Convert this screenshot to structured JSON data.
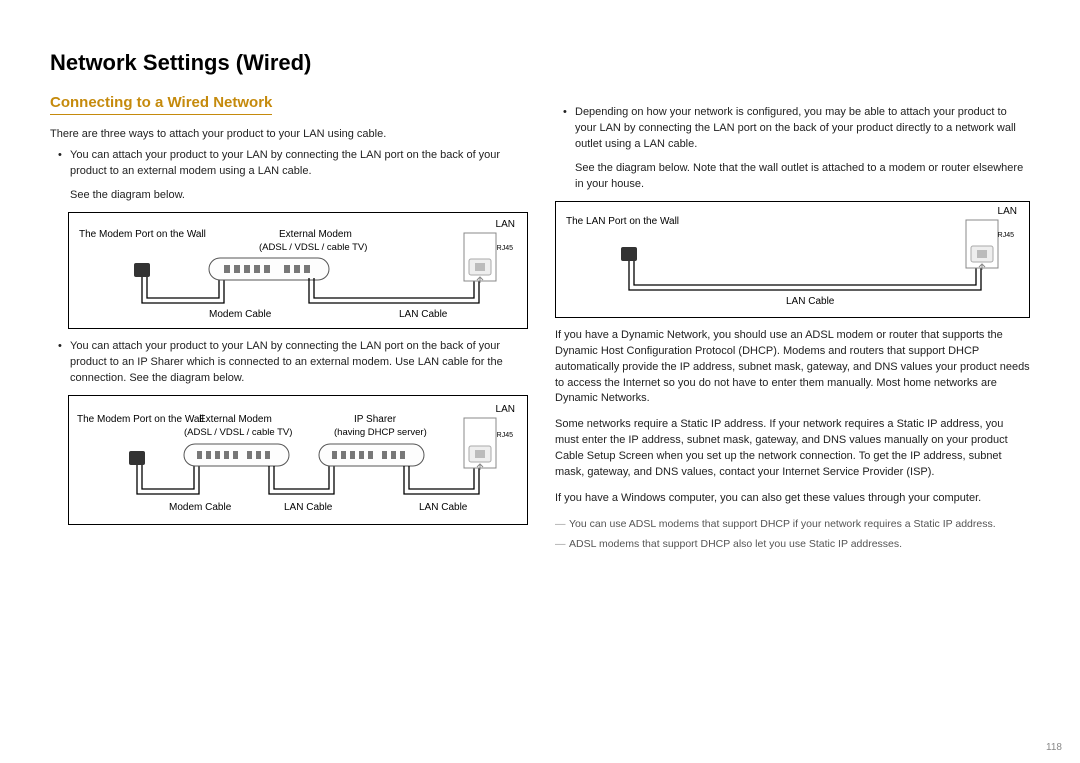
{
  "title": "Network Settings (Wired)",
  "subtitle": "Connecting to a Wired Network",
  "intro": "There are three ways to attach your product to your LAN using cable.",
  "left_bullets": [
    "You can attach your product to your LAN by connecting the LAN port on the back of your product to an external modem using a LAN cable.",
    "You can attach your product to your LAN by connecting the LAN port on the back of your product to an IP Sharer which is connected to an external modem. Use LAN cable for the connection. See the diagram below."
  ],
  "see_diagram": "See the diagram below.",
  "diagram1": {
    "wall_label": "The Modem Port on the Wall",
    "modem_label": "External Modem",
    "modem_sub": "(ADSL / VDSL / cable TV)",
    "lan": "LAN",
    "rj45": "RJ45",
    "modem_cable": "Modem Cable",
    "lan_cable": "LAN Cable"
  },
  "diagram2": {
    "wall_label": "The Modem Port on the Wall",
    "modem_label": "External Modem",
    "modem_sub": "(ADSL / VDSL / cable TV)",
    "sharer_label": "IP Sharer",
    "sharer_sub": "(having DHCP server)",
    "lan": "LAN",
    "rj45": "RJ45",
    "modem_cable": "Modem Cable",
    "lan_cable1": "LAN Cable",
    "lan_cable2": "LAN Cable"
  },
  "right_bullet": "Depending on how your network is configured, you may be able to attach your product to your LAN by connecting the LAN port on the back of your product directly to a network wall outlet using a LAN cable.",
  "right_sub": "See the diagram below. Note that the wall outlet is attached to a modem or router elsewhere in your house.",
  "diagram3": {
    "wall_label": "The LAN Port on the Wall",
    "lan": "LAN",
    "rj45": "RJ45",
    "lan_cable": "LAN Cable"
  },
  "para1": "If you have a Dynamic Network, you should use an ADSL modem or router that supports the Dynamic Host Configuration Protocol (DHCP). Modems and routers that support DHCP automatically provide the IP address, subnet mask, gateway, and DNS values your product needs to access the Internet so you do not have to enter them manually. Most home networks are Dynamic Networks.",
  "para2": "Some networks require a Static IP address. If your network requires a Static IP address, you must enter the IP address, subnet mask, gateway, and DNS values manually on your product Cable Setup Screen when you set up the network connection. To get the IP address, subnet mask, gateway, and DNS values, contact your Internet Service Provider (ISP).",
  "para3": "If you have a Windows computer, you can also get these values through your computer.",
  "notes": [
    "You can use ADSL modems that support DHCP if your network requires a Static IP address.",
    "ADSL modems that support DHCP also let you use Static IP addresses."
  ],
  "page_number": "118"
}
